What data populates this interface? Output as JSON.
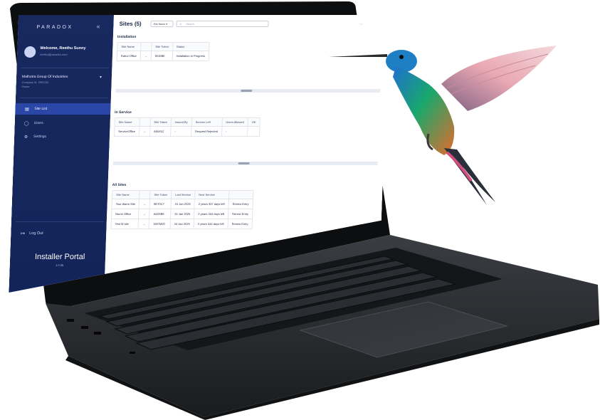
{
  "sidebar": {
    "brand": "PARADOX",
    "collapse_icon": "«",
    "welcome": "Welcome, Reethu Sunny",
    "email": "reethu@paradox.com",
    "company": "Malhotra Group Of Industries",
    "company_sub": "Company Id: 7891234",
    "company_role": "Owner",
    "nav": [
      {
        "label": "Site List",
        "icon": "list-icon"
      },
      {
        "label": "Users",
        "icon": "user-icon"
      },
      {
        "label": "Settings",
        "icon": "gear-icon"
      }
    ],
    "logout": "Log Out",
    "portal_title": "Installer Portal",
    "portal_version": "1.0.35"
  },
  "main": {
    "title": "Sites (5)",
    "filter_select": "Site Name",
    "search_placeholder": "Search",
    "installation": {
      "title": "Installation",
      "headers": [
        "Site Name",
        "Site Token",
        "Status"
      ],
      "rows": [
        [
          "Rahul Office",
          "→",
          "92408E",
          "Installation in Progress"
        ]
      ]
    },
    "in_service": {
      "title": "In Service",
      "headers": [
        "Site Name",
        "Site Token",
        "Issued By",
        "Service Left",
        "Users Allowed"
      ],
      "rows": [
        [
          "ServiceOffice",
          "→",
          "ANUGC",
          "-",
          "Request Rejected",
          "-"
        ]
      ],
      "extra": "OK"
    },
    "all_sites": {
      "title": "All Sites",
      "headers": [
        "Site Name",
        "Site Token",
        "Last Service",
        "Next Service"
      ],
      "rows": [
        [
          "Your Alarm Site",
          "→",
          "9D70C7",
          "24 Jan 2025",
          "2 years 337 days left",
          "Renew Entry"
        ],
        [
          "Home Office",
          "→",
          "A4D5B9",
          "24 Jan 2025",
          "2 years 344 days left",
          "Renew Entry"
        ],
        [
          "Test M site",
          "→",
          "1937M20",
          "24 Jan 2025",
          "2 years 344 days left",
          "Renew Entry"
        ]
      ]
    }
  },
  "colors": {
    "sidebar": "#17295e",
    "active_nav": "#2a47a8",
    "status_progress": "#7a2ea8",
    "status_rejected": "#e0562a",
    "link_green": "#2e9a53"
  }
}
